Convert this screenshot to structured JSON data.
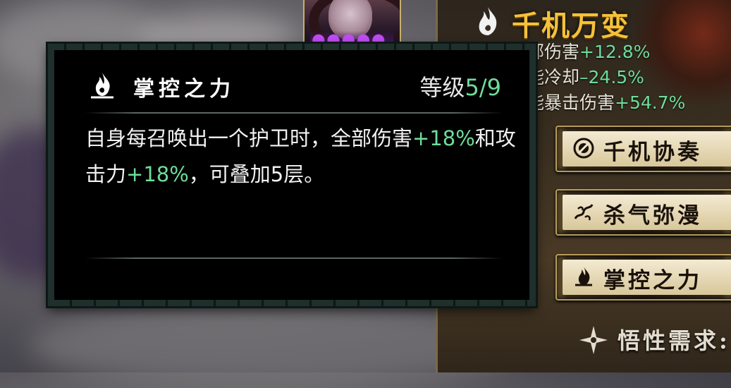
{
  "skill_panel": {
    "title": "千机万变",
    "stats": [
      {
        "label": "角色全部伤害",
        "value": "+12.8%"
      },
      {
        "label": "技能冷却",
        "value": "–24.5%"
      },
      {
        "label": "技能暴击伤害",
        "value": "+54.7%"
      }
    ],
    "subskills": [
      {
        "name": "千机协奏",
        "icon": "gear-sigil-icon"
      },
      {
        "name": "杀气弥漫",
        "icon": "dragon-swirl-icon"
      },
      {
        "name": "掌控之力",
        "icon": "flame-lotus-icon"
      }
    ],
    "requirement_label": "悟性需求:"
  },
  "tooltip": {
    "name": "掌控之力",
    "level_label": "等级",
    "level_value": "5/9",
    "desc": {
      "p1": "自身每召唤出一个护卫时，全部伤害",
      "v1": "+18%",
      "p2": "和攻击力",
      "v2": "+18%",
      "p3": "，可叠加5层。"
    }
  },
  "colors": {
    "accent_green": "#6fdc9a",
    "title_gold": "#f4c23a",
    "tooltip_border": "#1e2f2c"
  }
}
